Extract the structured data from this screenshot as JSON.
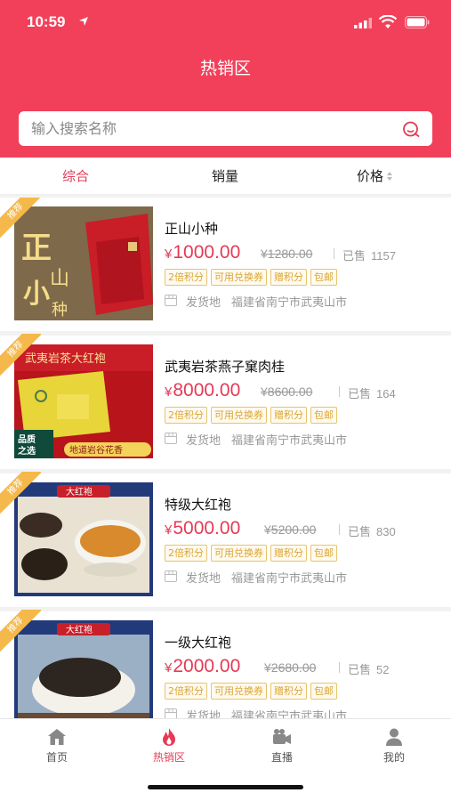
{
  "status_bar": {
    "time": "10:59"
  },
  "header": {
    "title": "热销区"
  },
  "search": {
    "placeholder": "输入搜索名称"
  },
  "sort_tabs": [
    {
      "label": "综合",
      "active": true
    },
    {
      "label": "销量",
      "active": false
    },
    {
      "label": "价格",
      "active": false
    }
  ],
  "products": [
    {
      "badge": "推荐",
      "name": "正山小种",
      "currency": "¥",
      "price": "1000.00",
      "original_price": "¥1280.00",
      "sold_label": "已售",
      "sold_count": "1157",
      "tags": [
        "2倍积分",
        "可用兑换券",
        "赠积分",
        "包邮"
      ],
      "ship_label": "发货地",
      "ship_from": "福建省南宁市武夷山市",
      "image_text": [
        "正",
        "山",
        "小",
        "种"
      ]
    },
    {
      "badge": "推荐",
      "name": "武夷岩茶燕子窠肉桂",
      "currency": "¥",
      "price": "8000.00",
      "original_price": "¥8600.00",
      "sold_label": "已售",
      "sold_count": "164",
      "tags": [
        "2倍积分",
        "可用兑换券",
        "赠积分",
        "包邮"
      ],
      "ship_label": "发货地",
      "ship_from": "福建省南宁市武夷山市",
      "image_text": [
        "武夷岩茶大红袍",
        "品质",
        "之选",
        "地道岩谷花香"
      ]
    },
    {
      "badge": "推荐",
      "name": "特级大红袍",
      "currency": "¥",
      "price": "5000.00",
      "original_price": "¥5200.00",
      "sold_label": "已售",
      "sold_count": "830",
      "tags": [
        "2倍积分",
        "可用兑换券",
        "赠积分",
        "包邮"
      ],
      "ship_label": "发货地",
      "ship_from": "福建省南宁市武夷山市",
      "image_text": [
        "大红袍"
      ]
    },
    {
      "badge": "推荐",
      "name": "一级大红袍",
      "currency": "¥",
      "price": "2000.00",
      "original_price": "¥2680.00",
      "sold_label": "已售",
      "sold_count": "52",
      "tags": [
        "2倍积分",
        "可用兑换券",
        "赠积分",
        "包邮"
      ],
      "ship_label": "发货地",
      "ship_from": "福建省南宁市武夷山市",
      "image_text": [
        "大红袍"
      ]
    }
  ],
  "tabbar": [
    {
      "label": "首页",
      "icon": "home-icon",
      "active": false
    },
    {
      "label": "热销区",
      "icon": "flame-icon",
      "active": true
    },
    {
      "label": "直播",
      "icon": "video-camera-icon",
      "active": false
    },
    {
      "label": "我的",
      "icon": "user-icon",
      "active": false
    }
  ],
  "colors": {
    "brand": "#f2405a",
    "price": "#e53a56",
    "tag": "#d9a531",
    "badge": "#f5b84a"
  }
}
